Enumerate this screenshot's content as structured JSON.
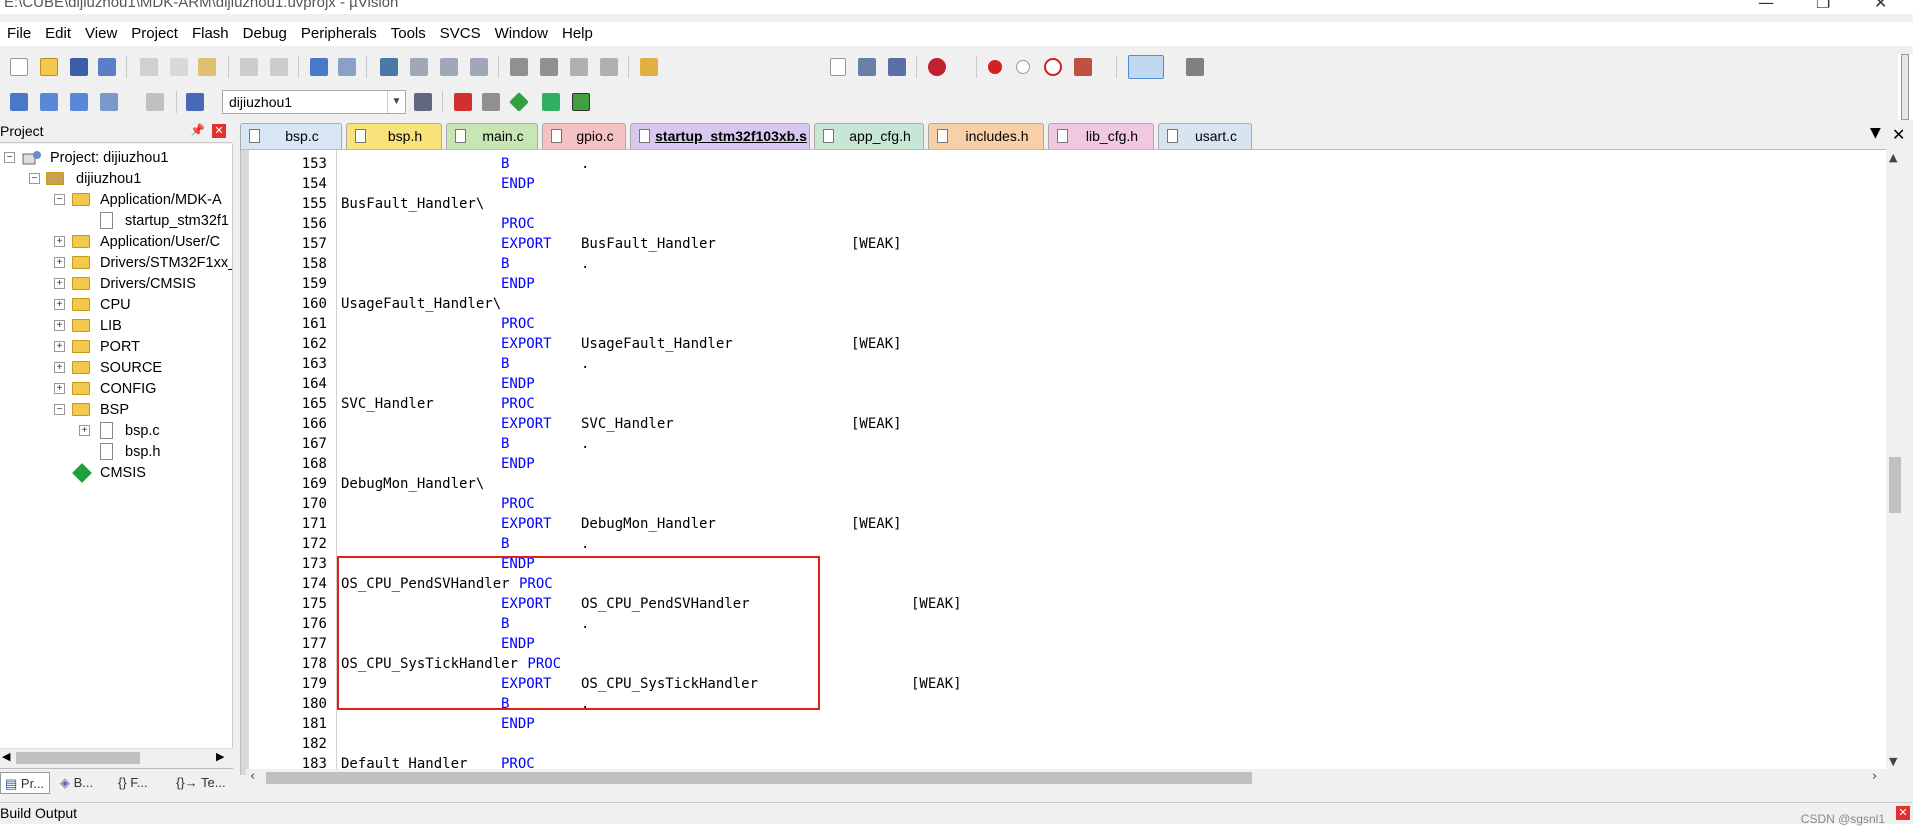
{
  "window": {
    "title": "E:\\CUBE\\dijiuzhou1\\MDK-ARM\\dijiuzhou1.uvprojx - µVision"
  },
  "menu": [
    "File",
    "Edit",
    "View",
    "Project",
    "Flash",
    "Debug",
    "Peripherals",
    "Tools",
    "SVCS",
    "Window",
    "Help"
  ],
  "build_toolbar": {
    "target": "dijiuzhou1"
  },
  "project_panel": {
    "title": "Project",
    "root": "Project: dijiuzhou1",
    "target": "dijiuzhou1",
    "groups": [
      {
        "label": "Application/MDK-A",
        "expanded": true
      },
      {
        "label": "startup_stm32f1",
        "file": true
      },
      {
        "label": "Application/User/C",
        "expanded": false
      },
      {
        "label": "Drivers/STM32F1xx_",
        "expanded": false
      },
      {
        "label": "Drivers/CMSIS",
        "expanded": false
      },
      {
        "label": "CPU",
        "expanded": false
      },
      {
        "label": "LIB",
        "expanded": false
      },
      {
        "label": "PORT",
        "expanded": false
      },
      {
        "label": "SOURCE",
        "expanded": false
      },
      {
        "label": "CONFIG",
        "expanded": false
      },
      {
        "label": "BSP",
        "expanded": true
      },
      {
        "label": "bsp.c",
        "file": true
      },
      {
        "label": "bsp.h",
        "file": true
      },
      {
        "label": "CMSIS",
        "cmsis": true
      }
    ],
    "bottom_tabs": [
      "Pr...",
      "B...",
      "{} F...",
      "{}→ Te..."
    ]
  },
  "editor_tabs": [
    {
      "label": "bsp.c",
      "color": "#d9e6f5"
    },
    {
      "label": "bsp.h",
      "color": "#f8e27a"
    },
    {
      "label": "main.c",
      "color": "#c8e6b4"
    },
    {
      "label": "gpio.c",
      "color": "#f4c2c2"
    },
    {
      "label": "startup_stm32f103xb.s",
      "color": "#d8c8f0",
      "active": true
    },
    {
      "label": "app_cfg.h",
      "color": "#c8e6d4"
    },
    {
      "label": "includes.h",
      "color": "#f8d0a8"
    },
    {
      "label": "lib_cfg.h",
      "color": "#f0c8e0"
    },
    {
      "label": "usart.c",
      "color": "#d8e4f0"
    }
  ],
  "code_lines": [
    {
      "n": "153",
      "label": "",
      "op": "B",
      "arg": ".",
      "attr": ""
    },
    {
      "n": "154",
      "label": "",
      "op": "ENDP",
      "arg": "",
      "attr": ""
    },
    {
      "n": "155",
      "label": "BusFault_Handler\\",
      "op": "",
      "arg": "",
      "attr": ""
    },
    {
      "n": "156",
      "label": "",
      "op": "PROC",
      "arg": "",
      "attr": ""
    },
    {
      "n": "157",
      "label": "",
      "op": "EXPORT",
      "arg": "BusFault_Handler",
      "attr": "[WEAK]"
    },
    {
      "n": "158",
      "label": "",
      "op": "B",
      "arg": ".",
      "attr": ""
    },
    {
      "n": "159",
      "label": "",
      "op": "ENDP",
      "arg": "",
      "attr": ""
    },
    {
      "n": "160",
      "label": "UsageFault_Handler\\",
      "op": "",
      "arg": "",
      "attr": ""
    },
    {
      "n": "161",
      "label": "",
      "op": "PROC",
      "arg": "",
      "attr": ""
    },
    {
      "n": "162",
      "label": "",
      "op": "EXPORT",
      "arg": "UsageFault_Handler",
      "attr": "[WEAK]"
    },
    {
      "n": "163",
      "label": "",
      "op": "B",
      "arg": ".",
      "attr": ""
    },
    {
      "n": "164",
      "label": "",
      "op": "ENDP",
      "arg": "",
      "attr": ""
    },
    {
      "n": "165",
      "label": "SVC_Handler",
      "op": "PROC",
      "arg": "",
      "attr": ""
    },
    {
      "n": "166",
      "label": "",
      "op": "EXPORT",
      "arg": "SVC_Handler",
      "attr": "[WEAK]"
    },
    {
      "n": "167",
      "label": "",
      "op": "B",
      "arg": ".",
      "attr": ""
    },
    {
      "n": "168",
      "label": "",
      "op": "ENDP",
      "arg": "",
      "attr": ""
    },
    {
      "n": "169",
      "label": "DebugMon_Handler\\",
      "op": "",
      "arg": "",
      "attr": ""
    },
    {
      "n": "170",
      "label": "",
      "op": "PROC",
      "arg": "",
      "attr": ""
    },
    {
      "n": "171",
      "label": "",
      "op": "EXPORT",
      "arg": "DebugMon_Handler",
      "attr": "[WEAK]"
    },
    {
      "n": "172",
      "label": "",
      "op": "B",
      "arg": ".",
      "attr": ""
    },
    {
      "n": "173",
      "label": "",
      "op": "ENDP",
      "arg": "",
      "attr": ""
    },
    {
      "n": "174",
      "label": "OS_CPU_PendSVHandler",
      "op": "PROC",
      "arg": "",
      "attr": ""
    },
    {
      "n": "175",
      "label": "",
      "op": "EXPORT",
      "arg": "OS_CPU_PendSVHandler",
      "attr": "[WEAK]"
    },
    {
      "n": "176",
      "label": "",
      "op": "B",
      "arg": ".",
      "attr": ""
    },
    {
      "n": "177",
      "label": "",
      "op": "ENDP",
      "arg": "",
      "attr": ""
    },
    {
      "n": "178",
      "label": "OS_CPU_SysTickHandler",
      "op": "PROC",
      "arg": "",
      "attr": ""
    },
    {
      "n": "179",
      "label": "",
      "op": "EXPORT",
      "arg": "OS_CPU_SysTickHandler",
      "attr": "[WEAK]"
    },
    {
      "n": "180",
      "label": "",
      "op": "B",
      "arg": ".",
      "attr": ""
    },
    {
      "n": "181",
      "label": "",
      "op": "ENDP",
      "arg": "",
      "attr": ""
    },
    {
      "n": "182",
      "label": "",
      "op": "",
      "arg": "",
      "attr": ""
    },
    {
      "n": "183",
      "label": "Default_Handler",
      "op": "PROC",
      "arg": "",
      "attr": ""
    }
  ],
  "build_output": {
    "title": "Build Output"
  },
  "watermark": "CSDN @sgsnl1",
  "colors": {
    "keyword": "#0000ff",
    "highlight_box": "#e02020"
  }
}
